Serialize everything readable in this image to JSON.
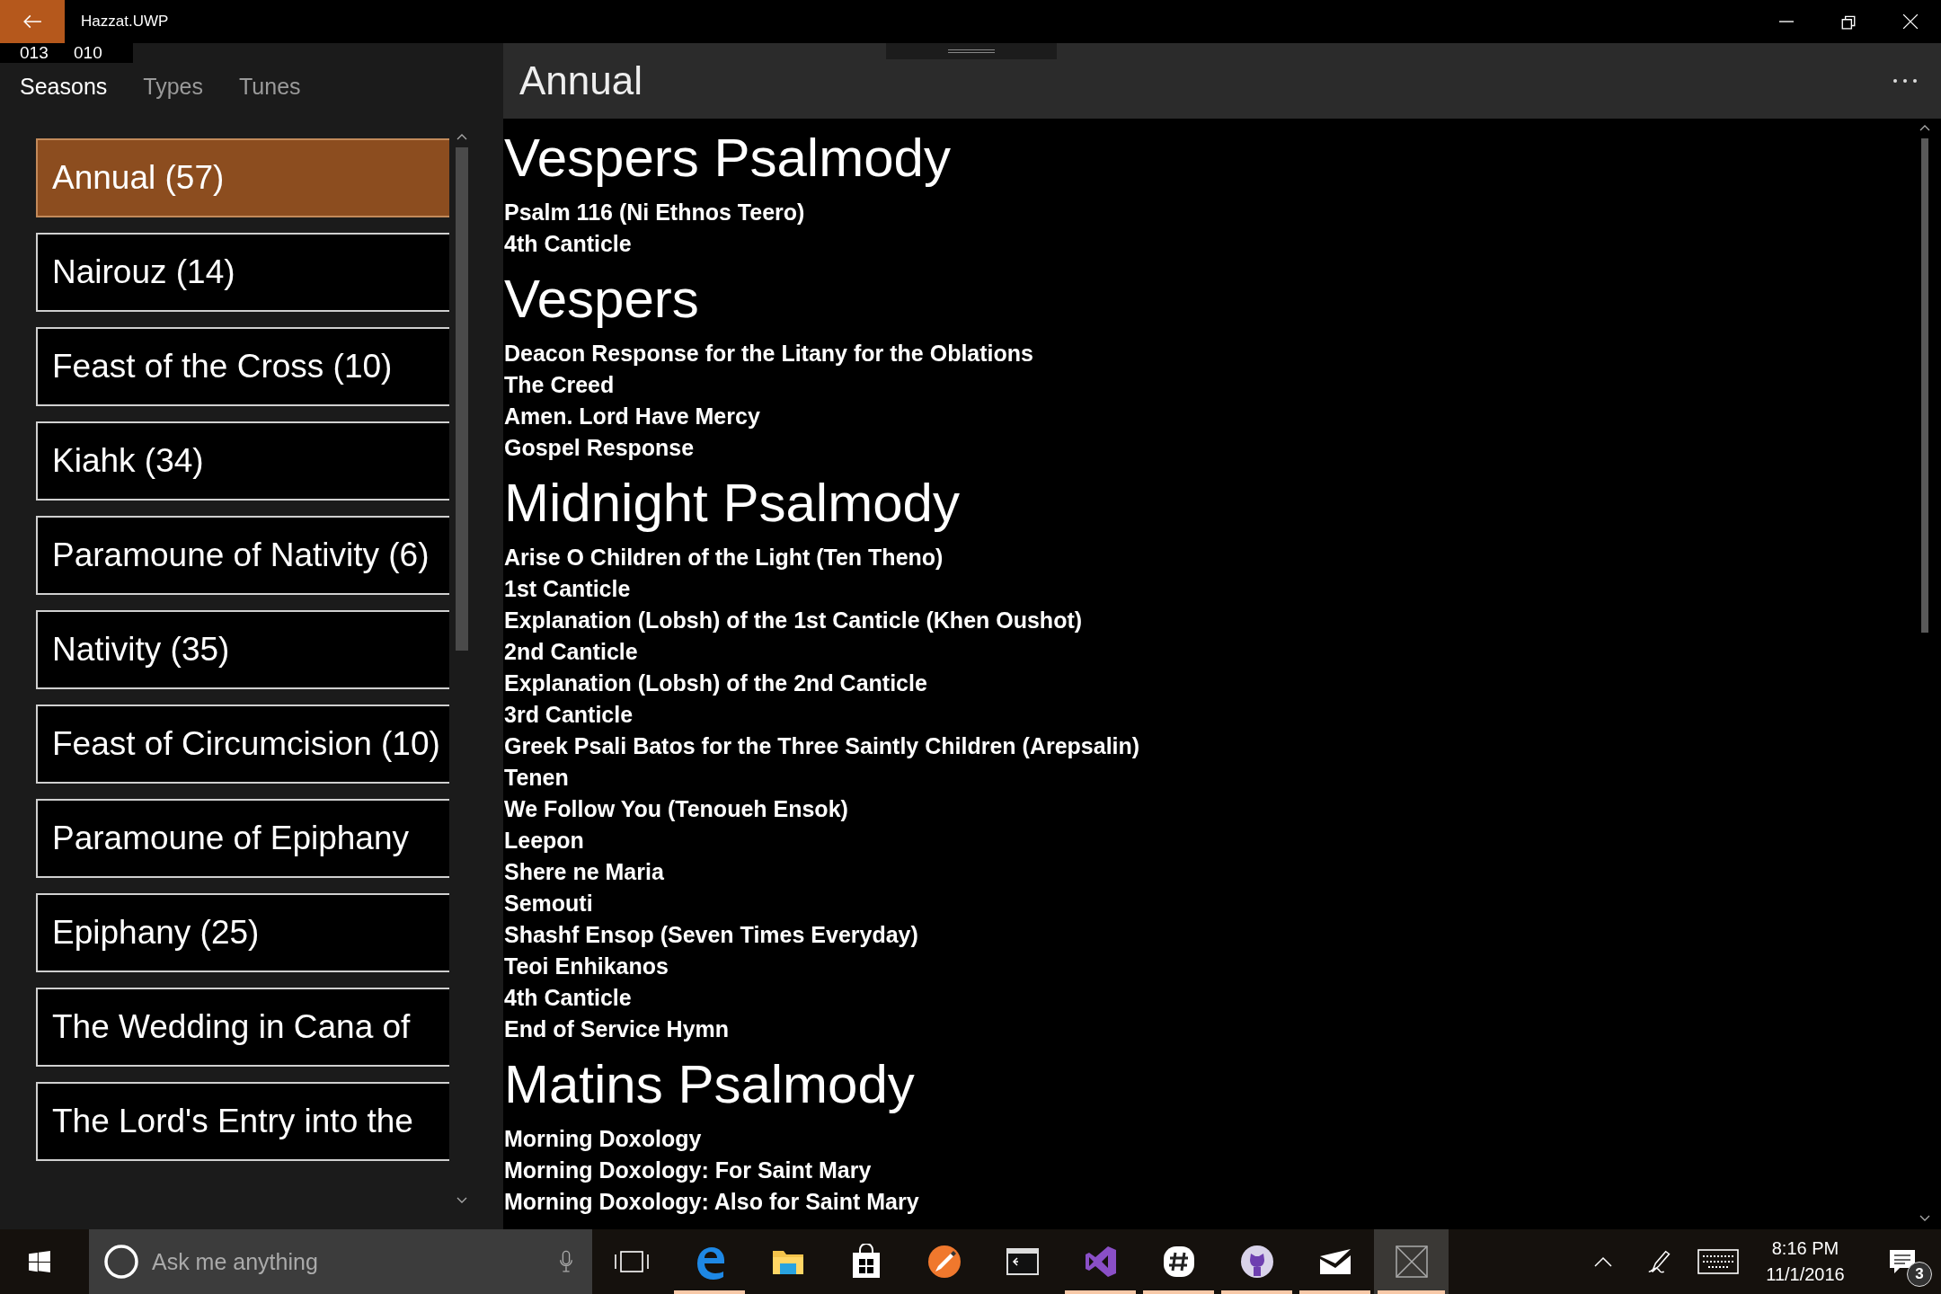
{
  "window": {
    "title": "Hazzat.UWP"
  },
  "counters": [
    "013",
    "010"
  ],
  "tabs": [
    {
      "label": "Seasons",
      "selected": true
    },
    {
      "label": "Types",
      "selected": false
    },
    {
      "label": "Tunes",
      "selected": false
    }
  ],
  "seasons": [
    {
      "label": "Annual (57)",
      "selected": true
    },
    {
      "label": "Nairouz (14)",
      "selected": false
    },
    {
      "label": "Feast of the Cross (10)",
      "selected": false
    },
    {
      "label": "Kiahk (34)",
      "selected": false
    },
    {
      "label": "Paramoune of Nativity (6)",
      "selected": false
    },
    {
      "label": "Nativity (35)",
      "selected": false
    },
    {
      "label": "Feast of Circumcision (10)",
      "selected": false
    },
    {
      "label": "Paramoune of Epiphany",
      "selected": false
    },
    {
      "label": "Epiphany (25)",
      "selected": false
    },
    {
      "label": "The Wedding in Cana of",
      "selected": false
    },
    {
      "label": "The Lord's Entry into the",
      "selected": false
    }
  ],
  "content": {
    "title": "Annual",
    "sections": [
      {
        "heading": "Vespers Psalmody",
        "items": [
          "Psalm 116 (Ni Ethnos Teero)",
          "4th Canticle"
        ]
      },
      {
        "heading": "Vespers",
        "items": [
          "Deacon Response for the Litany for the Oblations",
          "The Creed",
          "Amen.  Lord Have Mercy",
          "Gospel Response"
        ]
      },
      {
        "heading": "Midnight Psalmody",
        "items": [
          "Arise O Children of the Light (Ten Theno)",
          "1st Canticle",
          "Explanation (Lobsh) of the 1st Canticle (Khen Oushot)",
          "2nd Canticle",
          "Explanation (Lobsh) of the 2nd Canticle",
          "3rd Canticle",
          "Greek Psali Batos for the Three Saintly Children (Arepsalin)",
          "Tenen",
          "We Follow You (Tenoueh Ensok)",
          "Leepon",
          "Shere ne Maria",
          "Semouti",
          "Shashf Ensop (Seven Times Everyday)",
          "Teoi Enhikanos",
          "4th Canticle",
          "End of Service Hymn"
        ]
      },
      {
        "heading": "Matins Psalmody",
        "items": [
          "Morning Doxology",
          "Morning Doxology: For Saint Mary",
          "Morning Doxology: Also for Saint Mary"
        ]
      }
    ]
  },
  "taskbar": {
    "search": {
      "placeholder": "Ask me anything"
    },
    "apps": [
      {
        "kind": "edge",
        "running": true,
        "active": false
      },
      {
        "kind": "explorer",
        "running": false,
        "active": false
      },
      {
        "kind": "store",
        "running": false,
        "active": false
      },
      {
        "kind": "paint",
        "running": false,
        "active": false
      },
      {
        "kind": "cmd",
        "running": false,
        "active": false
      },
      {
        "kind": "studio",
        "running": true,
        "active": false
      },
      {
        "kind": "chat",
        "running": true,
        "active": false
      },
      {
        "kind": "github",
        "running": true,
        "active": false
      },
      {
        "kind": "mail",
        "running": true,
        "active": false
      },
      {
        "kind": "app",
        "running": true,
        "active": true
      }
    ],
    "time": "8:16 PM",
    "date": "11/1/2016",
    "notifications": "3"
  }
}
